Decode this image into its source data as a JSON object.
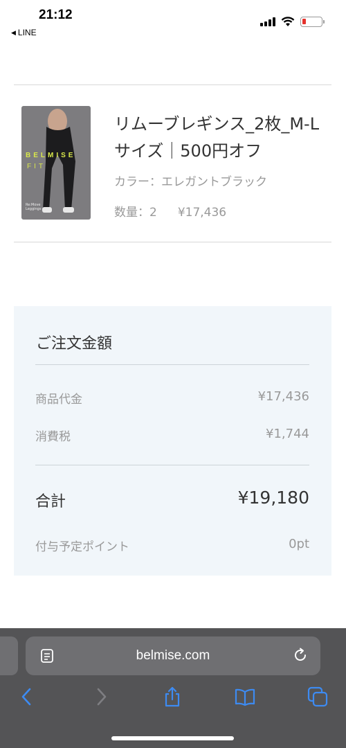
{
  "status_bar": {
    "time": "21:12",
    "back_app": "LINE"
  },
  "product": {
    "title": "リムーブレギンス_2枚_M-Lサイズ｜500円オフ",
    "color_line": "カラー：エレガントブラック",
    "quantity": "数量：2",
    "price": "¥17,436",
    "thumbnail": {
      "brand": "BELMISE",
      "sub": "FIT",
      "caption_1": "Re:Move",
      "caption_2": "Leggings"
    }
  },
  "summary": {
    "title": "ご注文金額",
    "subtotal_label": "商品代金",
    "subtotal_value": "¥17,436",
    "tax_label": "消費税",
    "tax_value": "¥1,744",
    "total_label": "合計",
    "total_value": "¥19,180",
    "points_label": "付与予定ポイント",
    "points_value": "0pt"
  },
  "browser": {
    "url": "belmise.com",
    "icons": [
      "reader-icon",
      "reload-icon",
      "back-icon",
      "forward-icon",
      "share-icon",
      "bookmarks-icon",
      "tabs-icon"
    ],
    "accent": "#3d8bf2"
  }
}
